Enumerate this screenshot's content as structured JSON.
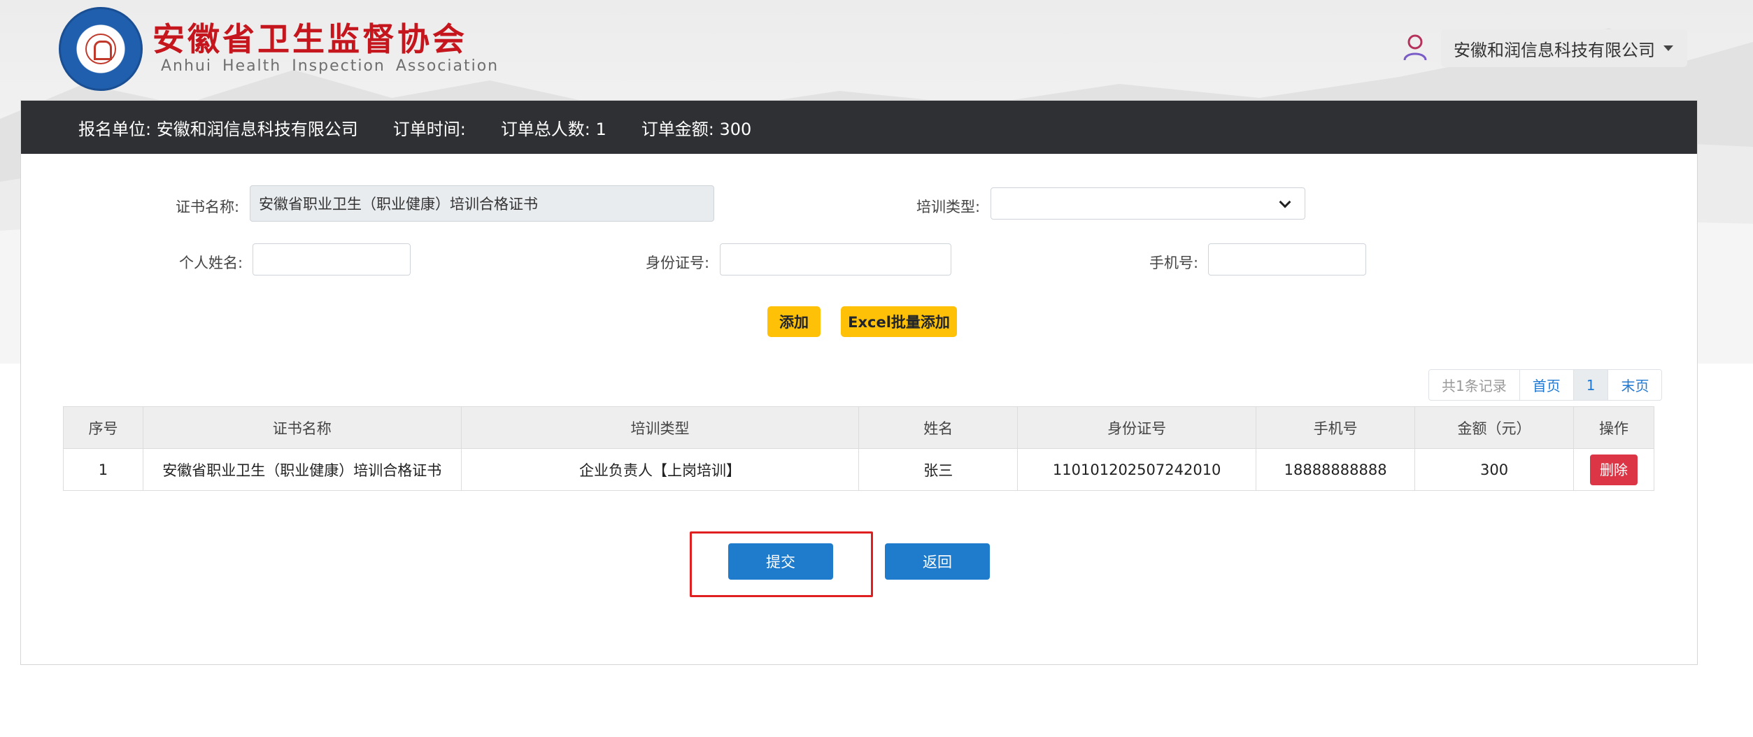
{
  "header": {
    "title": "安徽省卫生监督协会",
    "subtitle": "Anhui Health Inspection Association",
    "user_company": "安徽和润信息科技有限公司"
  },
  "order_info": {
    "unit": "报名单位: 安徽和润信息科技有限公司",
    "time": "订单时间:",
    "total_people": "订单总人数: 1",
    "amount": "订单金额: 300"
  },
  "form": {
    "cert_label": "证书名称:",
    "cert_value": "安徽省职业卫生（职业健康）培训合格证书",
    "training_type_label": "培训类型:",
    "training_type_value": "",
    "name_label": "个人姓名:",
    "name_value": "",
    "id_label": "身份证号:",
    "id_value": "",
    "phone_label": "手机号:",
    "phone_value": ""
  },
  "actions": {
    "add": "添加",
    "excel_add": "Excel批量添加",
    "submit": "提交",
    "back": "返回"
  },
  "pagination": {
    "summary": "共1条记录",
    "first": "首页",
    "current": "1",
    "last": "末页"
  },
  "table": {
    "headers": [
      "序号",
      "证书名称",
      "培训类型",
      "姓名",
      "身份证号",
      "手机号",
      "金额（元）",
      "操作"
    ],
    "rows": [
      {
        "index": "1",
        "cert": "安徽省职业卫生（职业健康）培训合格证书",
        "type": "企业负责人【上岗培训】",
        "name": "张三",
        "id": "110101202507242010",
        "phone": "18888888888",
        "amount": "300",
        "op": "删除"
      }
    ]
  },
  "colors": {
    "title_red": "#c4161c",
    "bar_dark": "#2f3033",
    "yellow": "#ffc107",
    "blue": "#1f7ccc",
    "danger": "#dc3545",
    "highlight": "#e02020"
  }
}
